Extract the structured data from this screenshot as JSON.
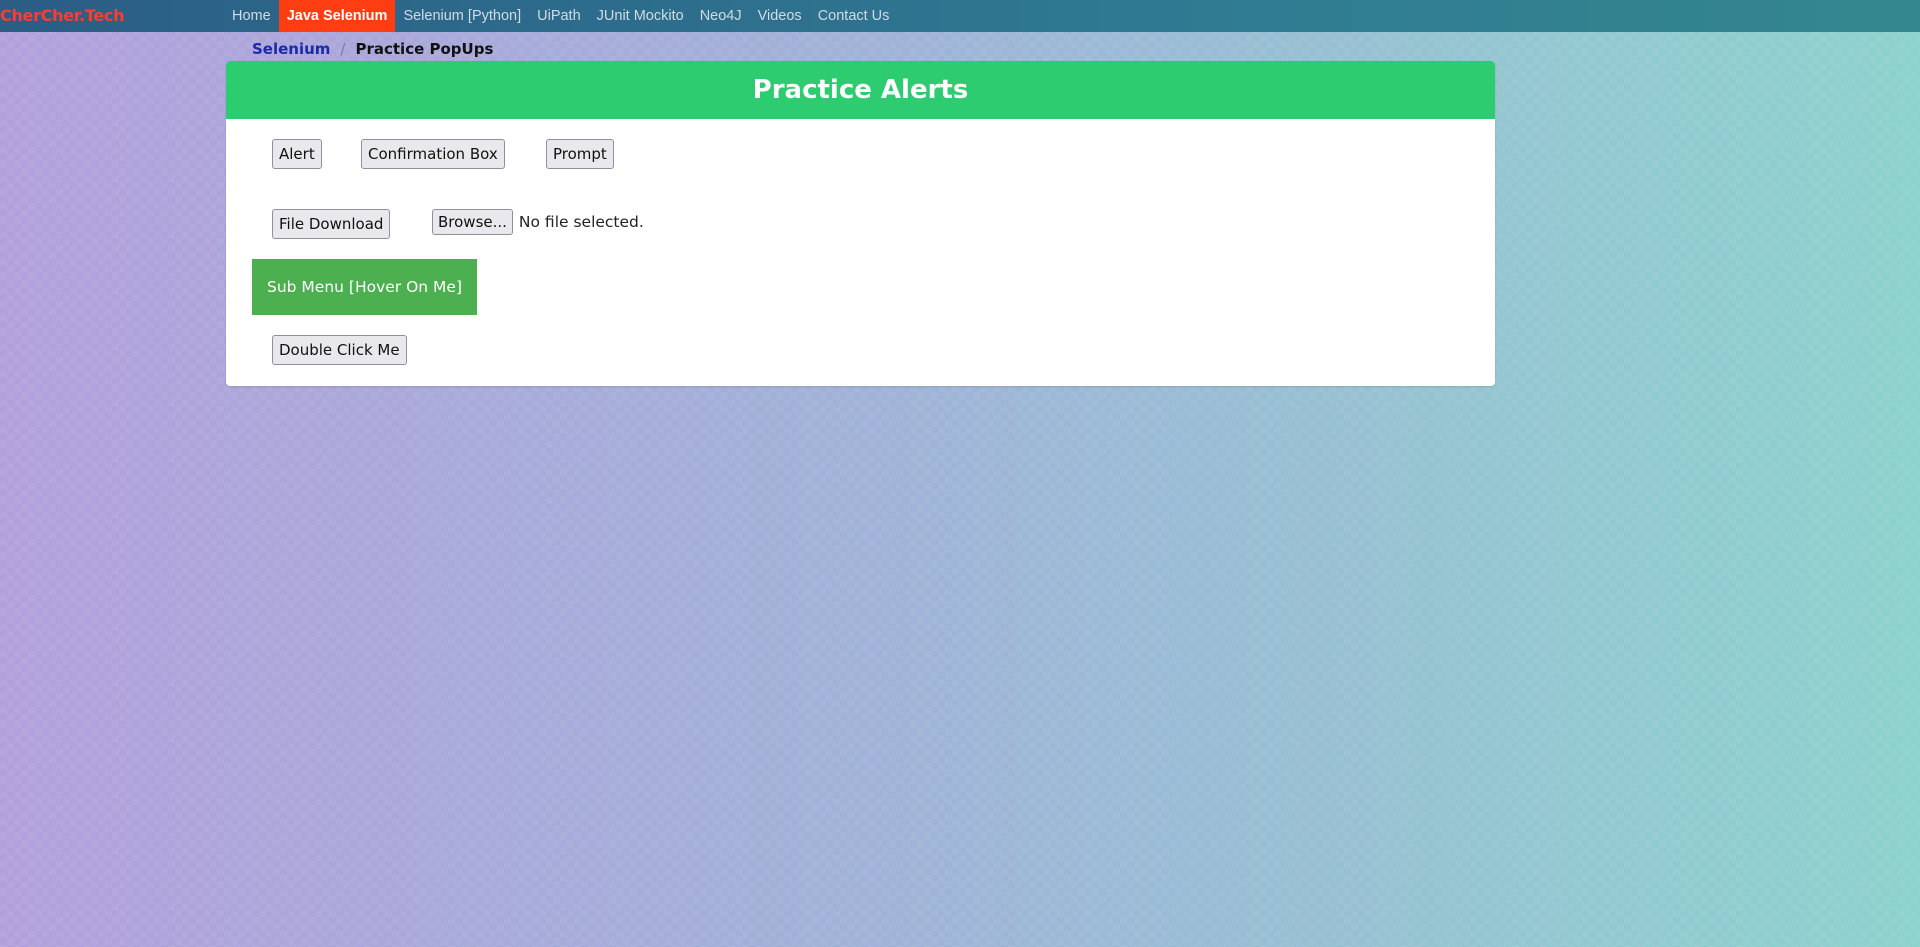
{
  "navbar": {
    "brand": "CherCher.Tech",
    "links": [
      {
        "label": "Home",
        "active": false
      },
      {
        "label": "Java Selenium",
        "active": true
      },
      {
        "label": "Selenium [Python]",
        "active": false
      },
      {
        "label": "UiPath",
        "active": false
      },
      {
        "label": "JUnit Mockito",
        "active": false
      },
      {
        "label": "Neo4J",
        "active": false
      },
      {
        "label": "Videos",
        "active": false
      },
      {
        "label": "Contact Us",
        "active": false
      }
    ]
  },
  "breadcrumb": {
    "parent": "Selenium",
    "separator": "/",
    "current": "Practice PopUps"
  },
  "card": {
    "title": "Practice Alerts",
    "buttons": {
      "alert": "Alert",
      "confirmation": "Confirmation Box",
      "prompt": "Prompt",
      "file_download": "File Download",
      "double_click": "Double Click Me"
    },
    "file_input": {
      "browse_label": "Browse...",
      "status": "No file selected."
    },
    "submenu_label": "Sub Menu [Hover On Me]"
  },
  "colors": {
    "navbar": "#2f7a92",
    "active_nav": "#ff3d12",
    "brand": "#ff3b30",
    "card_header": "#2ecc71",
    "submenu": "#4caf50"
  }
}
